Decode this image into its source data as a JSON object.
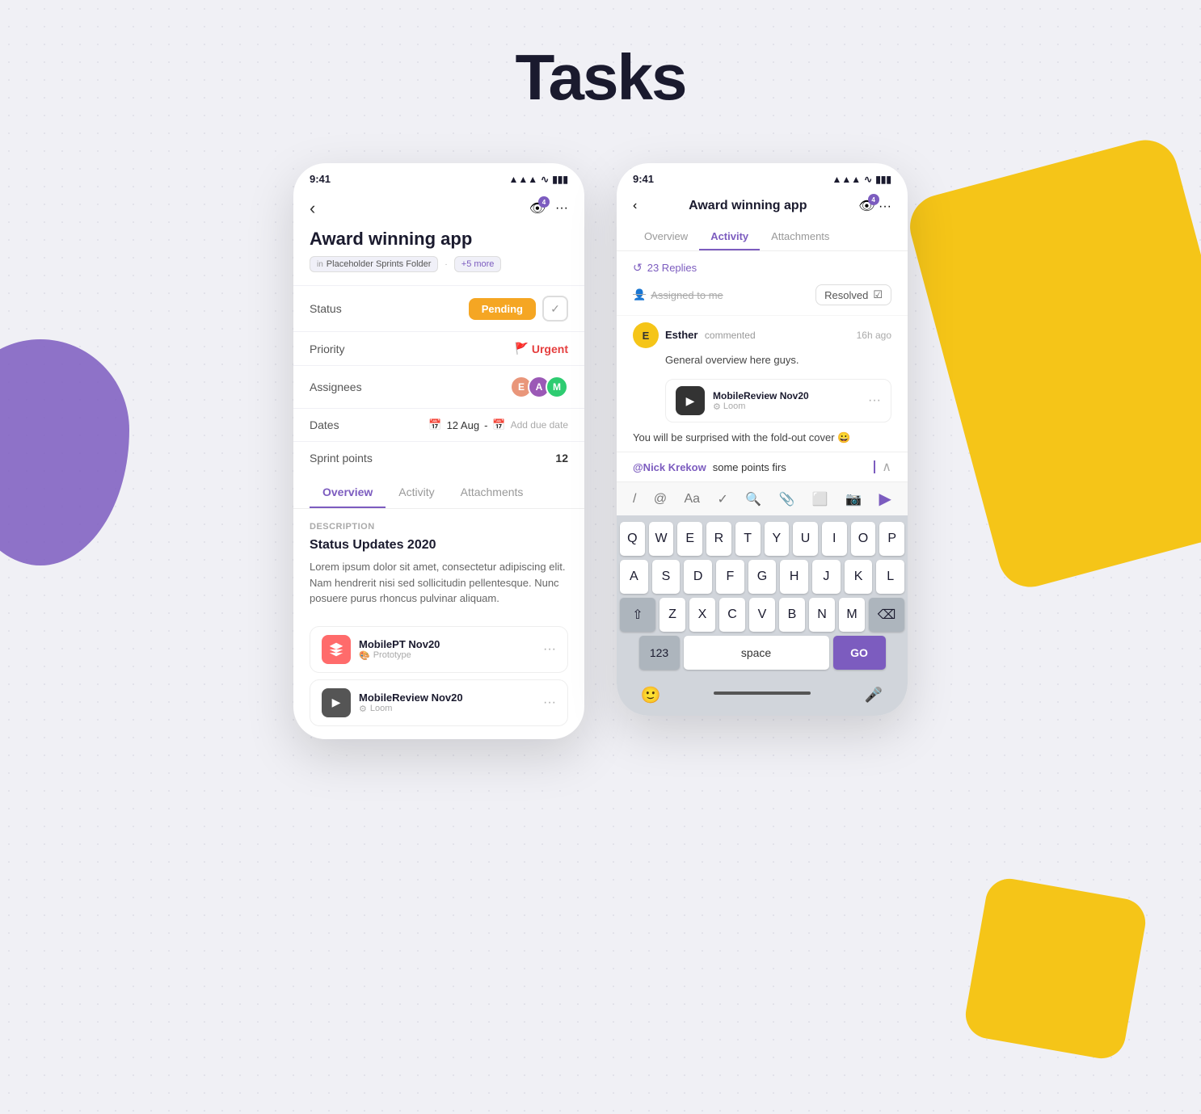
{
  "page": {
    "title": "Tasks",
    "bg_color": "#f0f0f5"
  },
  "phone1": {
    "status_bar": {
      "time": "9:41",
      "signal": "▲▲▲",
      "wifi": "WiFi",
      "battery": "🔋"
    },
    "header": {
      "back": "‹",
      "eye_badge": "4",
      "menu": "···"
    },
    "task_title": "Award winning app",
    "folder_tag": "Placeholder Sprints Folder",
    "more_tag": "+5 more",
    "fields": [
      {
        "label": "Status",
        "value": "Pending",
        "type": "badge"
      },
      {
        "label": "Priority",
        "value": "Urgent",
        "type": "priority"
      },
      {
        "label": "Assignees",
        "value": "avatars",
        "type": "avatars"
      },
      {
        "label": "Dates",
        "value": "12 Aug - Add due date",
        "type": "date"
      },
      {
        "label": "Sprint points",
        "value": "12",
        "type": "text"
      }
    ],
    "tabs": [
      "Overview",
      "Activity",
      "Attachments"
    ],
    "active_tab": "Overview",
    "description_label": "Description",
    "description_title": "Status Updates 2020",
    "description_text": "Lorem ipsum dolor sit amet, consectetur adipiscing elit. Nam hendrerit nisi sed sollicitudin pellentesque. Nunc posuere purus rhoncus pulvinar aliquam.",
    "attachments": [
      {
        "name": "MobilePT Nov20",
        "sub": "Prototype",
        "icon": "🎨",
        "icon_bg": "#ff6b6b"
      },
      {
        "name": "MobileReview Nov20",
        "sub": "Loom",
        "icon": "▶",
        "icon_bg": "#555"
      }
    ]
  },
  "phone2": {
    "status_bar": {
      "time": "9:41"
    },
    "header": {
      "back": "‹",
      "title": "Award winning app",
      "eye_badge": "4",
      "menu": "···"
    },
    "tabs": [
      "Overview",
      "Activity",
      "Attachments"
    ],
    "active_tab": "Activity",
    "replies_count": "23 Replies",
    "assigned_text": "Assigned to me",
    "resolved_text": "Resolved",
    "comment1": {
      "author": "Esther",
      "action": "commented",
      "time": "16h ago",
      "text": "General overview here guys.",
      "video": {
        "name": "MobileReview Nov20",
        "sub": "Loom"
      }
    },
    "comment2": {
      "text": "You will be surprised with the fold-out cover 😀"
    },
    "compose": {
      "mention": "@Nick Krekow",
      "input_text": "some points firs"
    },
    "toolbar_icons": [
      "/",
      "@",
      "Aa",
      "✓",
      "🔍",
      "📎",
      "⬜",
      "📷"
    ],
    "keyboard": {
      "row1": [
        "Q",
        "W",
        "E",
        "R",
        "T",
        "Y",
        "U",
        "I",
        "O",
        "P"
      ],
      "row2": [
        "A",
        "S",
        "D",
        "F",
        "G",
        "H",
        "J",
        "K",
        "L"
      ],
      "row3": [
        "Z",
        "X",
        "C",
        "V",
        "B",
        "N",
        "M"
      ],
      "bottom": {
        "num": "123",
        "space": "space",
        "go": "GO"
      }
    }
  }
}
